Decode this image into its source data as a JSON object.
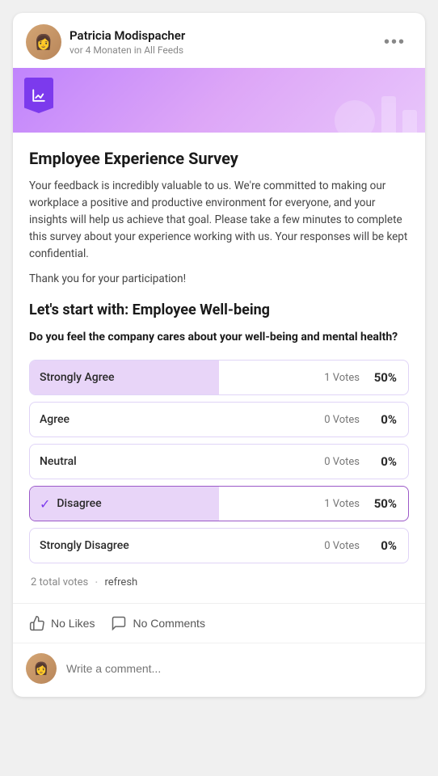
{
  "post": {
    "author_name": "Patricia Modispacher",
    "author_meta": "vor 4 Monaten in All Feeds",
    "more_icon": "•••"
  },
  "survey": {
    "title": "Employee Experience Survey",
    "description": "Your feedback is incredibly valuable to us. We're committed to making our workplace a positive and productive environment for everyone, and your insights will help us achieve that goal. Please take a few minutes to complete this survey about your experience working with us. Your responses will be kept confidential.",
    "thanks": "Thank you for your participation!",
    "section_title": "Let's start with: Employee Well-being",
    "question": "Do you feel the company cares about your well-being and mental health?",
    "options": [
      {
        "label": "Strongly Agree",
        "votes": 1,
        "votes_label": "1 Votes",
        "pct": "50%",
        "fill_pct": 50,
        "selected": false,
        "check": false
      },
      {
        "label": "Agree",
        "votes": 0,
        "votes_label": "0 Votes",
        "pct": "0%",
        "fill_pct": 0,
        "selected": false,
        "check": false
      },
      {
        "label": "Neutral",
        "votes": 0,
        "votes_label": "0 Votes",
        "pct": "0%",
        "fill_pct": 0,
        "selected": false,
        "check": false
      },
      {
        "label": "Disagree",
        "votes": 1,
        "votes_label": "1 Votes",
        "pct": "50%",
        "fill_pct": 50,
        "selected": true,
        "check": true
      },
      {
        "label": "Strongly Disagree",
        "votes": 0,
        "votes_label": "0 Votes",
        "pct": "0%",
        "fill_pct": 0,
        "selected": false,
        "check": false
      }
    ],
    "total_votes": "2 total votes",
    "refresh_label": "refresh"
  },
  "actions": {
    "like_label": "No Likes",
    "comment_label": "No Comments"
  },
  "comment_placeholder": "Write a comment..."
}
